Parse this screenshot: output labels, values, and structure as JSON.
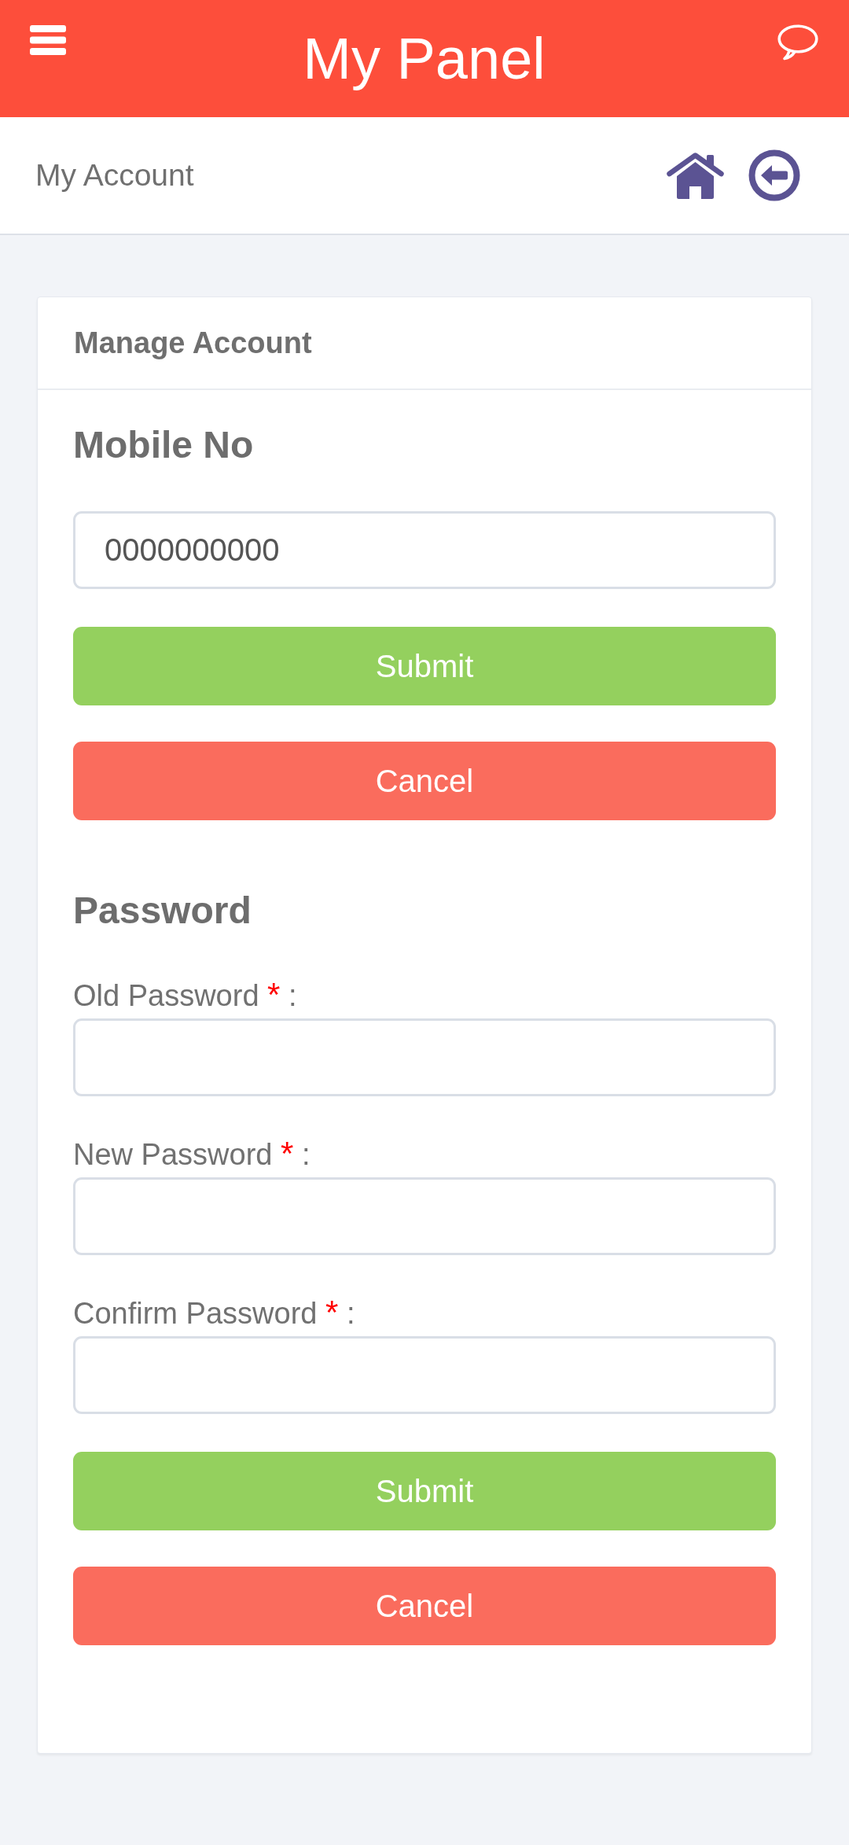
{
  "header": {
    "title": "My Panel"
  },
  "subheader": {
    "title": "My Account"
  },
  "card": {
    "title": "Manage Account",
    "sections": [
      {
        "heading": "Mobile No",
        "fields": [
          {
            "value": "0000000000"
          }
        ],
        "buttons": [
          {
            "kind": "submit",
            "label": "Submit"
          },
          {
            "kind": "cancel",
            "label": "Cancel"
          }
        ]
      },
      {
        "heading": "Password",
        "fields": [
          {
            "label": "Old Password",
            "required_mark": "*",
            "suffix": ":"
          },
          {
            "label": "New Password",
            "required_mark": "*",
            "suffix": ":"
          },
          {
            "label": "Confirm Password",
            "required_mark": "*",
            "suffix": ":"
          }
        ],
        "buttons": [
          {
            "kind": "submit",
            "label": "Submit"
          },
          {
            "kind": "cancel",
            "label": "Cancel"
          }
        ]
      }
    ]
  }
}
